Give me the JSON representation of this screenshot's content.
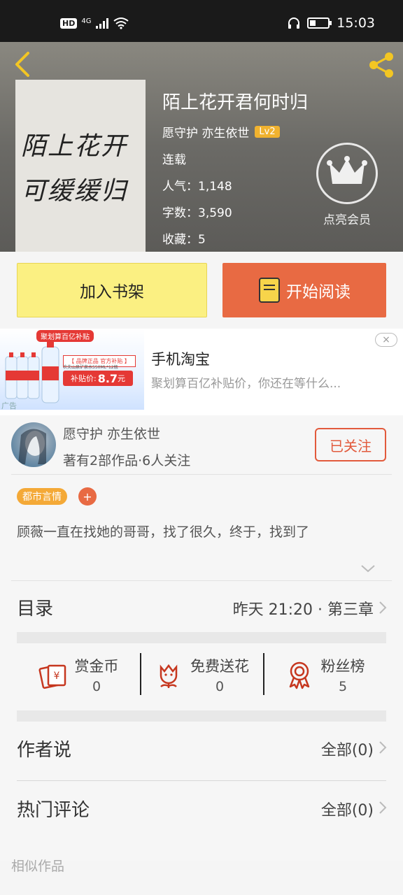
{
  "status_bar": {
    "hd": "HD",
    "network": "4G",
    "time": "15:03",
    "battery_level": 0.35
  },
  "book": {
    "title": "陌上花开君何时归",
    "author": "愿守护 亦生依世",
    "level": "Lv2",
    "status": "连载",
    "popularity": "人气：1,148",
    "word_count": "字数：3,590",
    "favorites": "收藏：5",
    "cover_text_line1": "陌上花开",
    "cover_text_line2": "可缓缓归"
  },
  "vip": {
    "label": "点亮会员"
  },
  "actions": {
    "add_shelf": "加入书架",
    "start_reading": "开始阅读"
  },
  "ad": {
    "title": "手机淘宝",
    "description": "聚划算百亿补贴价，你还在等什么...",
    "banner": "聚划算百亿补贴",
    "tag": "【 品牌正品 官方补贴 】",
    "product": "农夫山泉矿泉水550ML*12瓶",
    "price_label": "补贴价:",
    "price": "8.7",
    "price_unit": "元",
    "mark": "广告",
    "close": "×"
  },
  "author_card": {
    "name": "愿守护 亦生依世",
    "summary": "著有2部作品·6人关注",
    "follow_label": "已关注"
  },
  "tags": [
    "都市言情"
  ],
  "tag_add": "+",
  "synopsis": "顾薇一直在找她的哥哥，找了很久，终于，找到了",
  "catalog": {
    "label": "目录",
    "latest": "昨天 21:20 · 第三章"
  },
  "stats": [
    {
      "label": "赏金币",
      "value": "0",
      "icon": "reward-coin-icon"
    },
    {
      "label": "免费送花",
      "value": "0",
      "icon": "flower-icon"
    },
    {
      "label": "粉丝榜",
      "value": "5",
      "icon": "medal-icon"
    }
  ],
  "author_says": {
    "label": "作者说",
    "count": "全部(0)"
  },
  "hot_comments": {
    "label": "热门评论",
    "count": "全部(0)"
  },
  "similar_works": {
    "label": "相似作品"
  },
  "colors": {
    "accent_orange": "#e86a43",
    "shelf_yellow": "#fbf082",
    "tag_orange": "#f4a937",
    "level_badge": "#f0b22f"
  }
}
